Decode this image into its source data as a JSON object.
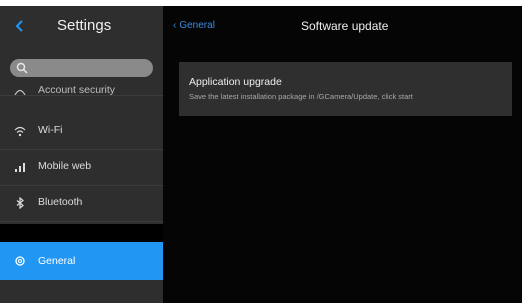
{
  "sidebar": {
    "title": "Settings",
    "items": [
      {
        "label": "Account security",
        "icon": "person-icon"
      },
      {
        "label": "Wi-Fi",
        "icon": "wifi-icon"
      },
      {
        "label": "Mobile web",
        "icon": "signal-bars-icon"
      },
      {
        "label": "Bluetooth",
        "icon": "bluetooth-icon"
      }
    ],
    "active_item": {
      "label": "General",
      "icon": "gear-icon"
    }
  },
  "header": {
    "back_label": "General",
    "title": "Software update"
  },
  "card": {
    "title": "Application upgrade",
    "description": "Save the latest installation package in /GCamera/Update, click start"
  },
  "colors": {
    "accent": "#2196f3",
    "sidebar_bg": "#2e2e2e",
    "main_bg": "#050505",
    "card_bg": "#2f2f2f"
  }
}
